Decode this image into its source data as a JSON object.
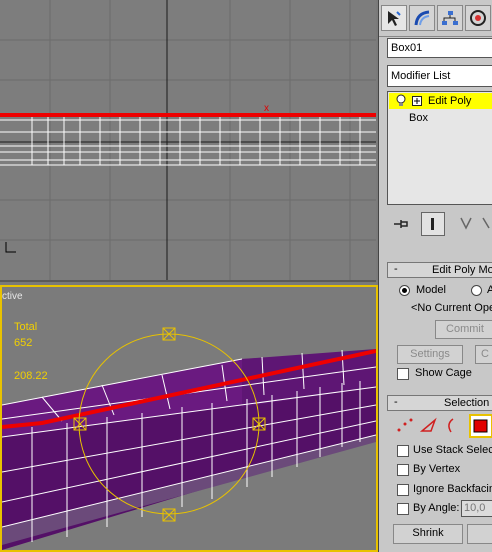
{
  "viewport_top": {
    "axis_mark": "x"
  },
  "viewport_persp": {
    "label": "ctive",
    "stats": {
      "total_label": "Total",
      "total_value": "652",
      "value2": "208.22"
    }
  },
  "panel": {
    "object_name": "Box01",
    "modifier_list": "Modifier List",
    "stack": [
      {
        "label": "Edit Poly",
        "selected": true
      },
      {
        "label": "Box",
        "selected": false
      }
    ],
    "edit_poly_rollout": {
      "title": "Edit Poly Mo",
      "mode_model": "Model",
      "mode_other": "A",
      "operation": "<No Current Oper",
      "commit": "Commit",
      "settings": "Settings",
      "other_btn": "C",
      "show_cage": "Show Cage"
    },
    "selection_rollout": {
      "title": "Selection",
      "use_stack": "Use Stack Selec",
      "by_vertex": "By Vertex",
      "ignore_backfacing": "Ignore Backfacin",
      "by_angle": "By Angle:",
      "by_angle_value": "10,0",
      "shrink": "Shrink"
    }
  },
  "colors": {
    "selection": "#ff0000",
    "gizmo": "#e8c200",
    "mesh": "#5a1470",
    "stack_highlight": "#ffff00"
  }
}
